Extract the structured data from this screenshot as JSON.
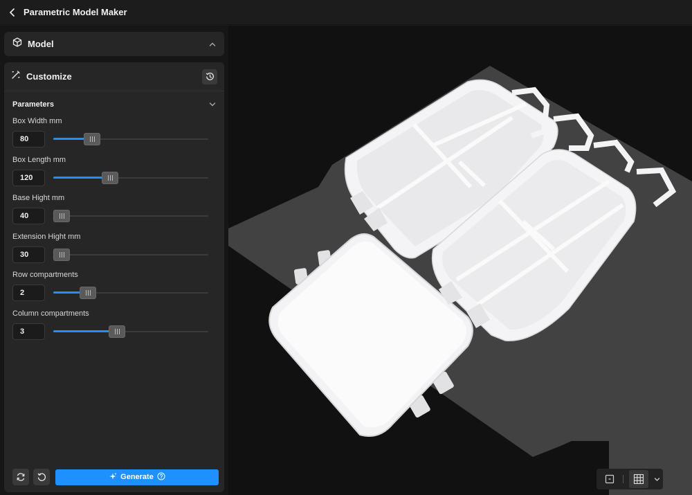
{
  "header": {
    "title": "Parametric Model Maker",
    "back_icon": "chevron-left-icon"
  },
  "model_panel": {
    "title": "Model",
    "icon": "cube-icon",
    "collapse_icon": "chevron-up-icon"
  },
  "customize_panel": {
    "title": "Customize",
    "icon": "magic-wand-icon",
    "history_icon": "history-icon",
    "parameters_title": "Parameters",
    "parameters_collapse_icon": "chevron-down-icon",
    "parameters": [
      {
        "label": "Box Width mm",
        "value": "80",
        "level": 0.22
      },
      {
        "label": "Box Length mm",
        "value": "120",
        "level": 0.35
      },
      {
        "label": "Base Hight mm",
        "value": "40",
        "level": 0.0
      },
      {
        "label": "Extension Hight mm",
        "value": "30",
        "level": 0.0
      },
      {
        "label": "Row compartments",
        "value": "2",
        "level": 0.19
      },
      {
        "label": "Column compartments",
        "value": "3",
        "level": 0.4
      }
    ]
  },
  "actions": {
    "regenerate_icon": "refresh-icon",
    "reset_icon": "undo-icon",
    "generate_label": "Generate",
    "generate_icon": "sparkle-icon",
    "help_icon": "help-circle-icon"
  },
  "view_controls": {
    "frame_icon": "frame-icon",
    "grid_icon": "grid-icon",
    "dropdown_icon": "chevron-down-icon"
  },
  "colors": {
    "accent": "#1e90ff",
    "background": "#1c1c1d",
    "panel": "#262627",
    "model": "#f4f4f6",
    "ground": "#434343"
  }
}
